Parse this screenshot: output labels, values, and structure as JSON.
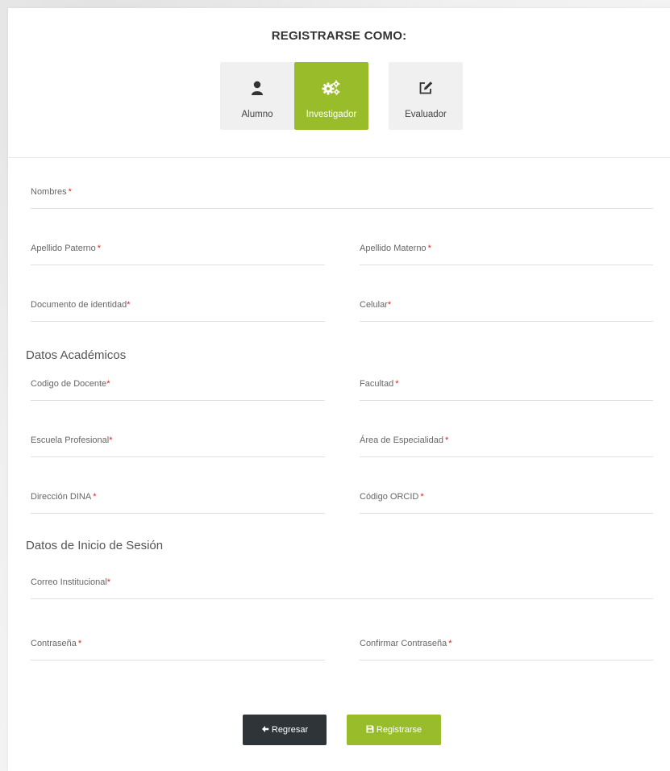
{
  "header": {
    "title": "REGISTRARSE COMO:"
  },
  "roles": [
    {
      "label": "Alumno",
      "icon": "user-icon"
    },
    {
      "label": "Investigador",
      "icon": "gears-icon"
    },
    {
      "label": "Evaluador",
      "icon": "edit-icon"
    }
  ],
  "active_role": "Investigador",
  "fields": {
    "nombres": "Nombres",
    "apellido_paterno": "Apellido Paterno",
    "apellido_materno": "Apellido Materno",
    "documento": "Documento de identidad",
    "celular": "Celular",
    "codigo_docente": "Codigo de Docente",
    "facultad": "Facultad",
    "escuela": "Escuela Profesional",
    "area": "Área de Especialidad",
    "direccion_dina": "Dirección DINA",
    "orcid": "Código ORCID",
    "correo": "Correo Institucional",
    "contrasena": "Contraseña",
    "confirmar": "Confirmar Contraseña"
  },
  "required_mark": "*",
  "sections": {
    "academicos": "Datos Académicos",
    "sesion": "Datos de Inicio de Sesión"
  },
  "buttons": {
    "back": "Regresar",
    "register": "Registrarse"
  },
  "colors": {
    "accent": "#99bc2b",
    "dark_button": "#2f3438",
    "required": "#e02020"
  }
}
